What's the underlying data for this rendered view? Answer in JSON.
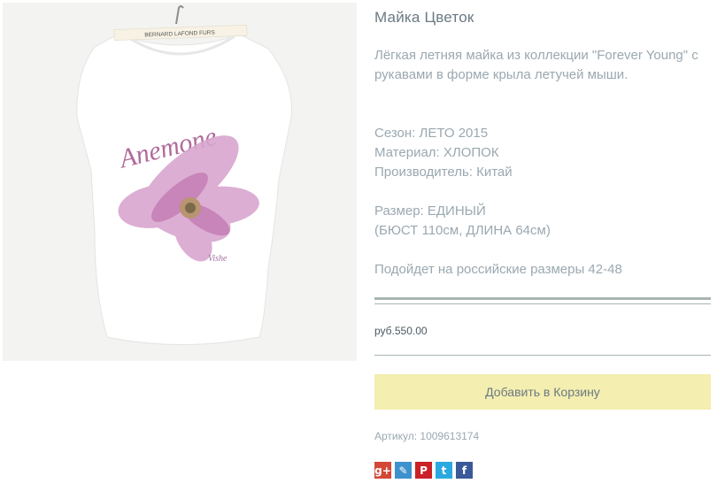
{
  "product": {
    "title": "Майка Цветок",
    "description": "Лёгкая летняя майка из коллекции \"Forever Young\" с рукавами в форме крыла летучей мыши.",
    "season": "Сезон: ЛЕТО 2015",
    "material": "Материал: ХЛОПОК",
    "manufacturer": "Производитель: Китай",
    "size": "Размер: ЕДИНЫЙ",
    "measurements": "(БЮСТ 110см, ДЛИНА 64см)",
    "fit_note": "Подойдет на российские размеры 42-48",
    "price": "руб.550.00",
    "add_to_cart": "Добавить в Корзину",
    "sku_label": "Артикул: ",
    "sku_value": "1009613174"
  },
  "image": {
    "label_text": "BERNARD LAFOND FURS",
    "print_text": "Anemone",
    "signature_text": "Vishe"
  },
  "social": [
    {
      "name": "google-plus-icon",
      "glyph": "g+",
      "color": "#d34836"
    },
    {
      "name": "livejournal-icon",
      "glyph": "✎",
      "color": "#3d91cc"
    },
    {
      "name": "pinterest-icon",
      "glyph": "P",
      "color": "#cb2027"
    },
    {
      "name": "twitter-icon",
      "glyph": "t",
      "color": "#2aa9e0"
    },
    {
      "name": "facebook-icon",
      "glyph": "f",
      "color": "#3b5998"
    }
  ]
}
